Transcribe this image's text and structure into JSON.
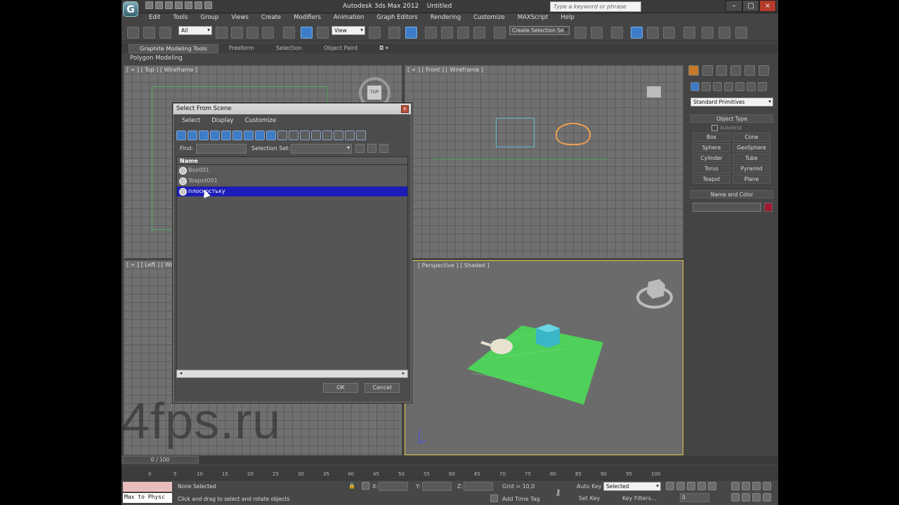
{
  "app": {
    "title": "Autodesk 3ds Max 2012",
    "document": "Untitled",
    "logo": "3ds",
    "search_placeholder": "Type a keyword or phrase"
  },
  "window_controls": [
    "–",
    "□",
    "×"
  ],
  "menu": [
    "Edit",
    "Tools",
    "Group",
    "Views",
    "Create",
    "Modifiers",
    "Animation",
    "Graph Editors",
    "Rendering",
    "Customize",
    "MAXScript",
    "Help"
  ],
  "toolbar": {
    "filter": "All",
    "refcoord": "View",
    "selection_set": "Create Selection Se"
  },
  "ribbon": {
    "tabs": [
      "Graphite Modeling Tools",
      "Freeform",
      "Selection",
      "Object Paint"
    ],
    "panel": "Polygon Modeling"
  },
  "viewports": {
    "top": "[ + ] [ Top ] [ Wireframe ]",
    "front": "[ + ] [ Front ] [ Wireframe ]",
    "left": "[ + ] [ Left ] [ Wirefr",
    "perspective": "[ Perspective ] [ Shaded ]",
    "viewcube_top": "TOP"
  },
  "command_panel": {
    "category": "Standard Primitives",
    "object_type_title": "Object Type",
    "autogrid": "AutoGrid",
    "buttons": [
      "Box",
      "Cone",
      "Sphere",
      "GeoSphere",
      "Cylinder",
      "Tube",
      "Torus",
      "Pyramid",
      "Teapot",
      "Plane"
    ],
    "name_color_title": "Name and Color",
    "color": "#a01a32"
  },
  "dialog": {
    "title": "Select From Scene",
    "close": "x",
    "menu": [
      "Select",
      "Display",
      "Customize"
    ],
    "find_label": "Find:",
    "selection_set_label": "Selection Set:",
    "column_name": "Name",
    "items": [
      {
        "name": "Box001",
        "selected": false
      },
      {
        "name": "Teapot001",
        "selected": false
      },
      {
        "name": "плоскостьку",
        "selected": true
      }
    ],
    "ok": "OK",
    "cancel": "Cancel"
  },
  "timeline": {
    "frame": "0 / 100",
    "ticks": [
      "0",
      "5",
      "10",
      "15",
      "20",
      "25",
      "30",
      "35",
      "40",
      "45",
      "50",
      "55",
      "60",
      "65",
      "70",
      "75",
      "80",
      "85",
      "90",
      "95",
      "100"
    ]
  },
  "status": {
    "selection": "None Selected",
    "prompt": "Click and drag to select and rotate objects",
    "maxscript": "Max to Physc",
    "x_label": "X:",
    "y_label": "Y:",
    "z_label": "Z:",
    "grid": "Grid = 10,0",
    "add_time_tag": "Add Time Tag",
    "auto_key": "Auto Key",
    "auto_key_value": "Selected",
    "set_key": "Set Key",
    "key_filters": "Key Filters...",
    "frame_value": "0"
  },
  "watermark": "4fps.ru"
}
